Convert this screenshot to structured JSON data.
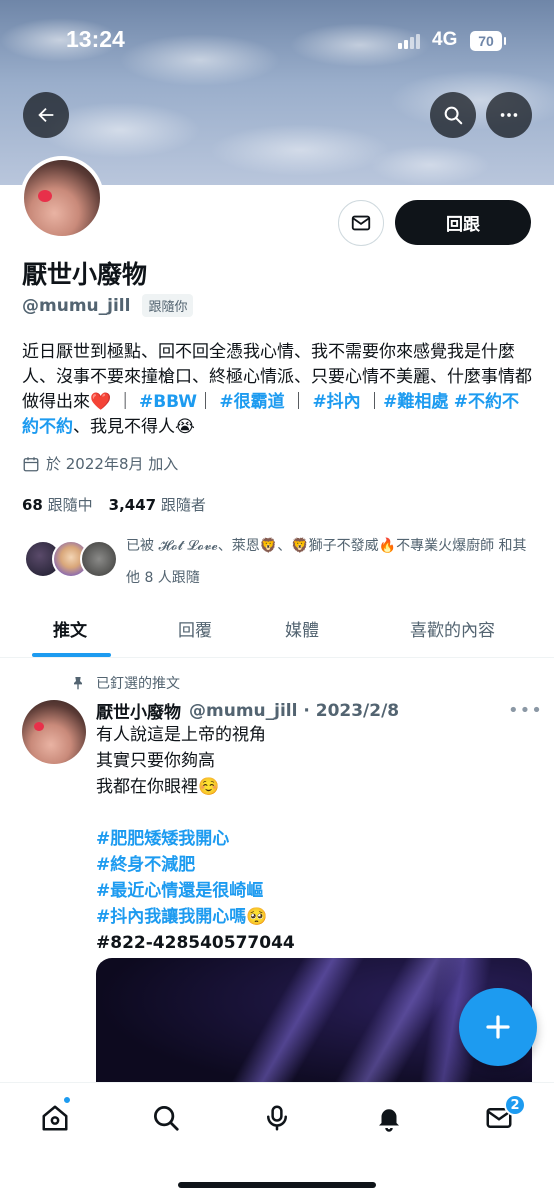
{
  "status_bar": {
    "time": "13:24",
    "network": "4G",
    "battery": "70"
  },
  "profile": {
    "name": "厭世小廢物",
    "handle": "@mumu_jill",
    "follows_you": "跟隨你",
    "follow_button": "回跟",
    "bio_parts": [
      {
        "text": "近日厭世到極點、回不回全憑我心情、我不需要你來感覺我是什麼人、沒事不要來撞槍口、終極心情派、只要心情不美麗、什麼事情都做得出來❤️ ｜ ",
        "tag": false
      },
      {
        "text": "#BBW",
        "tag": true
      },
      {
        "text": "｜ ",
        "tag": false
      },
      {
        "text": "#很霸道",
        "tag": true
      },
      {
        "text": " ｜ ",
        "tag": false
      },
      {
        "text": "#抖內",
        "tag": true
      },
      {
        "text": " ｜",
        "tag": false
      },
      {
        "text": "#難相處",
        "tag": true
      },
      {
        "text": " ",
        "tag": false
      },
      {
        "text": "#不約不約不約",
        "tag": true
      },
      {
        "text": "、我見不得人😭",
        "tag": false
      }
    ],
    "joined": "於 2022年8月 加入",
    "following_count": "68",
    "following_label": "跟隨中",
    "followers_count": "3,447",
    "followers_label": "跟隨者",
    "followers_you_know": "已被 𝓗𝓸𝓽 𝓛𝓸𝓿𝓮、萊恩🦁、🦁獅子不發威🔥不專業火爆廚師 和其他 8 人跟隨"
  },
  "tabs": [
    {
      "label": "推文",
      "active": true
    },
    {
      "label": "回覆",
      "active": false
    },
    {
      "label": "媒體",
      "active": false
    },
    {
      "label": "喜歡的內容",
      "active": false
    }
  ],
  "pinned_tweet": {
    "pinned_label": "已釘選的推文",
    "author_name": "厭世小廢物",
    "meta": "@mumu_jill · 2023/2/8",
    "lines": [
      {
        "text": "有人說這是上帝的視角",
        "style": "plain"
      },
      {
        "text": "其實只要你夠高",
        "style": "plain"
      },
      {
        "text": "我都在你眼裡☺️",
        "style": "plain"
      },
      {
        "text": " ",
        "style": "plain"
      },
      {
        "text": "#肥肥矮矮我開心",
        "style": "tag"
      },
      {
        "text": "#終身不減肥",
        "style": "tag"
      },
      {
        "text": "#最近心情還是很崎嶇",
        "style": "tag"
      },
      {
        "text": "#抖內我讓我開心嗎🥺",
        "style": "tag"
      },
      {
        "text": "#822-428540577044",
        "style": "strong"
      }
    ]
  },
  "bottom_nav": {
    "messages_badge": "2"
  },
  "colors": {
    "accent": "#1d9bf0",
    "text": "#0f1419",
    "muted": "#536471"
  }
}
